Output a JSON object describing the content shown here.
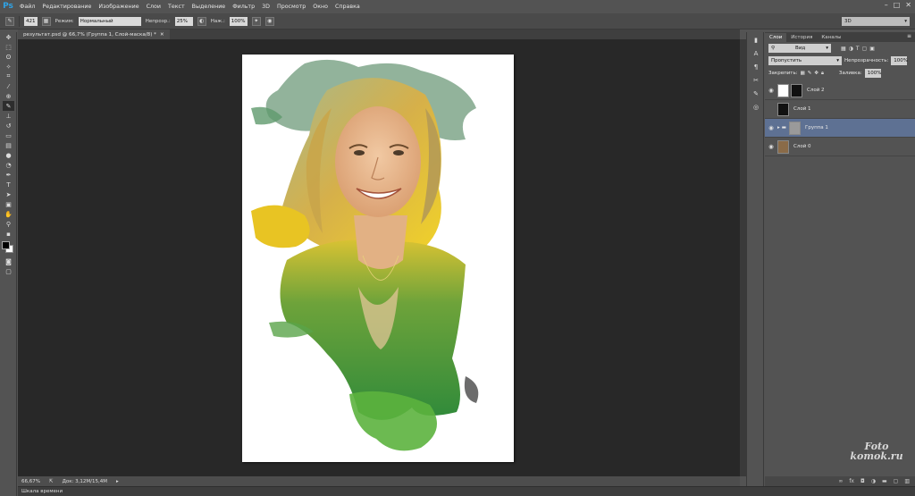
{
  "app": {
    "logo": "Ps",
    "window_controls": [
      "–",
      "□",
      "✕"
    ]
  },
  "menu": [
    "Файл",
    "Редактирование",
    "Изображение",
    "Слои",
    "Текст",
    "Выделение",
    "Фильтр",
    "3D",
    "Просмотр",
    "Окно",
    "Справка"
  ],
  "options": {
    "brush_size": "421",
    "mode_label": "Режим:",
    "mode_value": "Нормальный",
    "opacity_label": "Непрозр.:",
    "opacity_value": "25%",
    "flow_label": "Наж.:",
    "flow_value": "100%",
    "workspace": "3D"
  },
  "document": {
    "tab_title": "результат.psd @ 66,7% (Группа 1, Слой-маска/8) *"
  },
  "status": {
    "zoom": "66,67%",
    "doc_size": "Док: 3,12M/15,4M",
    "timeline": "Шкала времени"
  },
  "layers_panel": {
    "tabs": [
      "Слои",
      "История",
      "Каналы"
    ],
    "filter_label": "Вид",
    "blend_mode": "Пропустить",
    "opacity_label": "Непрозрачность:",
    "opacity_value": "100%",
    "lock_label": "Закрепить:",
    "fill_label": "Заливка:",
    "fill_value": "100%",
    "layers": [
      {
        "name": "Слой 2",
        "visible": true,
        "selected": false
      },
      {
        "name": "Слой 1",
        "visible": false,
        "selected": false
      },
      {
        "name": "Группа 1",
        "visible": true,
        "selected": true
      },
      {
        "name": "Слой 0",
        "visible": true,
        "selected": false
      }
    ]
  },
  "watermark": {
    "line1": "Foto",
    "line2": "komok.ru"
  },
  "colors": {
    "selected_layer": "#5e7193",
    "canvas_bg": "#282828",
    "ps_blue": "#2fa3e6"
  }
}
